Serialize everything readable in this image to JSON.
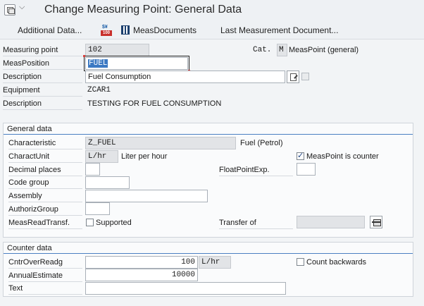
{
  "window": {
    "title": "Change Measuring Point: General Data"
  },
  "toolbar": {
    "additional_data": "Additional Data...",
    "meas_icon_top": "$¥",
    "meas_icon_bottom": "100",
    "meas_documents": "MeasDocuments",
    "last_measurement_document": "Last Measurement Document..."
  },
  "header": {
    "measuring_point_label": "Measuring point",
    "measuring_point_value": "102",
    "category_label": "Cat.",
    "category_value": "M",
    "category_text": "MeasPoint (general)",
    "meas_position_label": "MeasPosition",
    "meas_position_value": "FUEL",
    "description_label": "Description",
    "description_value": "Fuel Consumption",
    "equipment_label": "Equipment",
    "equipment_value": "ZCAR1",
    "equipment_description_label": "Description",
    "equipment_description_value": "TESTING FOR FUEL CONSUMPTION"
  },
  "general_data": {
    "title": "General data",
    "characteristic_label": "Characteristic",
    "characteristic_value": "Z_FUEL",
    "characteristic_text": "Fuel (Petrol)",
    "charact_unit_label": "CharactUnit",
    "charact_unit_value": "L/hr",
    "charact_unit_text": "Liter per hour",
    "meas_point_is_counter_label": "MeasPoint is counter",
    "meas_point_is_counter": true,
    "decimal_places_label": "Decimal places",
    "decimal_places_value": "",
    "float_point_exp_label": "FloatPointExp.",
    "float_point_exp_value": "",
    "code_group_label": "Code group",
    "code_group_value": "",
    "assembly_label": "Assembly",
    "assembly_value": "",
    "authoriz_group_label": "AuthorizGroup",
    "authoriz_group_value": "",
    "meas_read_transf_label": "MeasReadTransf.",
    "supported_label": "Supported",
    "supported": false,
    "transfer_of_label": "Transfer of",
    "transfer_of_value": ""
  },
  "counter_data": {
    "title": "Counter data",
    "cntr_over_readg_label": "CntrOverReadg",
    "cntr_over_readg_value": "100",
    "cntr_over_readg_unit": "L/hr",
    "count_backwards_label": "Count backwards",
    "count_backwards": false,
    "annual_estimate_label": "AnnualEstimate",
    "annual_estimate_value": "10000",
    "text_label": "Text",
    "text_value": ""
  },
  "colors": {
    "accent": "#4a7fc1",
    "selection": "#3c79c3",
    "background": "#f2f4f6"
  }
}
